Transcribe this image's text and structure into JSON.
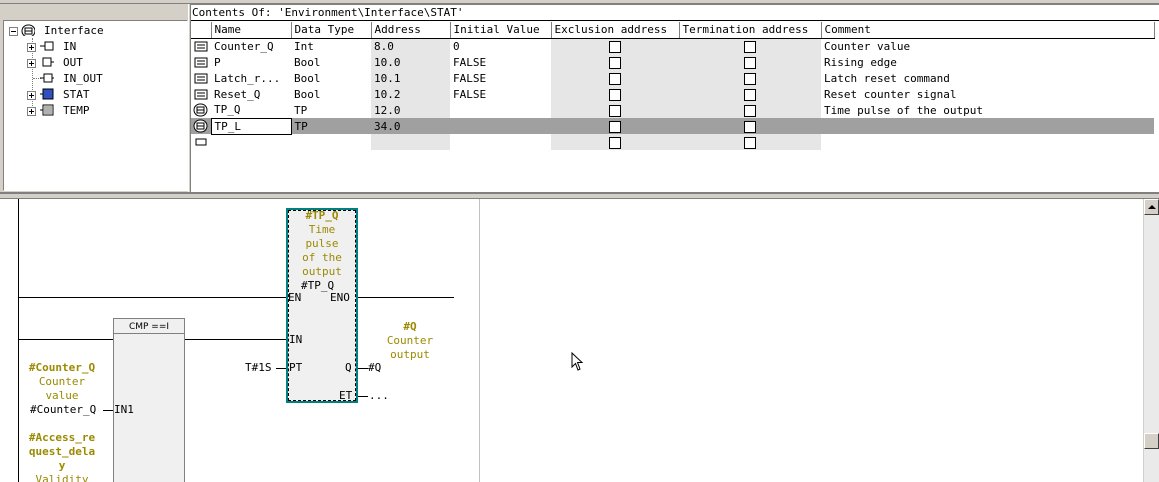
{
  "tree": {
    "root": "Interface",
    "items": [
      {
        "label": "IN",
        "expandable": true
      },
      {
        "label": "OUT",
        "expandable": true
      },
      {
        "label": "IN_OUT",
        "expandable": false
      },
      {
        "label": "STAT",
        "expandable": true
      },
      {
        "label": "TEMP",
        "expandable": true
      }
    ]
  },
  "table": {
    "contents_label": "Contents Of: 'Environment\\Interface\\STAT'",
    "columns": [
      "Name",
      "Data Type",
      "Address",
      "Initial Value",
      "Exclusion address",
      "Termination address",
      "Comment"
    ],
    "rows": [
      {
        "name": "Counter_Q",
        "type": "Int",
        "address": "8.0",
        "initial": "0",
        "comment": "Counter value",
        "icon": "var"
      },
      {
        "name": "P",
        "type": "Bool",
        "address": "10.0",
        "initial": "FALSE",
        "comment": "Rising edge",
        "icon": "var"
      },
      {
        "name": "Latch_r...",
        "type": "Bool",
        "address": "10.1",
        "initial": "FALSE",
        "comment": "Latch reset command",
        "icon": "var"
      },
      {
        "name": "Reset_Q",
        "type": "Bool",
        "address": "10.2",
        "initial": "FALSE",
        "comment": "Reset counter signal",
        "icon": "var"
      },
      {
        "name": "TP_Q",
        "type": "TP",
        "address": "12.0",
        "initial": "",
        "comment": "Time pulse of the output",
        "icon": "fb"
      },
      {
        "name": "TP_L",
        "type": "TP",
        "address": "34.0",
        "initial": "",
        "comment": "",
        "icon": "fb",
        "selected": true
      },
      {
        "name": "",
        "type": "",
        "address": "",
        "initial": "",
        "comment": "",
        "icon": "empty"
      }
    ]
  },
  "lad": {
    "tp_block": {
      "instance": "#TP_Q",
      "comment_lines": [
        "Time",
        "pulse",
        "of the",
        "output"
      ],
      "type_label": "#TP_Q",
      "pins": {
        "en": "EN",
        "eno": "ENO",
        "in": "IN",
        "pt": "PT",
        "q": "Q",
        "et": "ET"
      }
    },
    "pt_value": "T#1S",
    "q_out": "#Q",
    "et_out": "...",
    "q_label": {
      "name": "#Q",
      "comment_lines": [
        "Counter",
        "output"
      ]
    },
    "cmp_block": {
      "title": "CMP ==I",
      "pin_in1": "IN1"
    },
    "in1_operand": "#Counter_Q",
    "in1_label": {
      "name": "#Counter_Q",
      "comment_lines": [
        "Counter",
        "value"
      ]
    },
    "in2_label": {
      "name_lines": [
        "#Access_re",
        "quest_dela",
        "y"
      ],
      "comment_lines": [
        "Validity"
      ]
    }
  }
}
